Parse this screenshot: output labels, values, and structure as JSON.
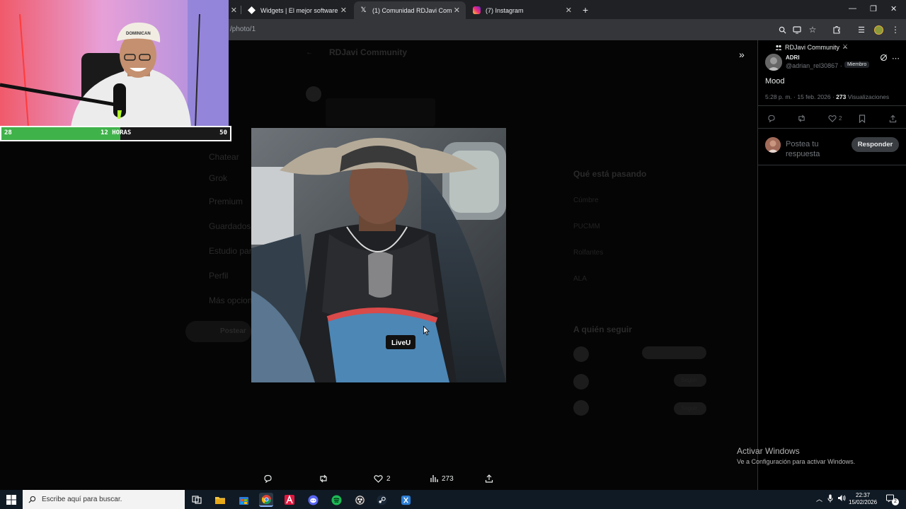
{
  "browser": {
    "tabs": [
      {
        "label": "Widgets | El mejor software pa",
        "favicon": "widgets-icon",
        "active": false
      },
      {
        "label": "(1) Comunidad RDJavi Commu",
        "favicon": "x-logo-icon",
        "active": true
      },
      {
        "label": "(7) Instagram",
        "favicon": "instagram-icon",
        "active": false
      }
    ],
    "address": "/photo/1"
  },
  "timer": {
    "left": "28",
    "center": "12 HORAS",
    "right": "50",
    "progress": 0.52,
    "accent": "#40b24a"
  },
  "background_page": {
    "header": "RDJavi Community",
    "nav": [
      "Chatear",
      "Grok",
      "Premium",
      "Guardados",
      "Estudio para",
      "Perfil",
      "Más opciones"
    ],
    "post_button": "Postear",
    "trending_title": "Qué está pasando",
    "trends": [
      "Cúmbre",
      "PUCMM",
      "Rolfantes",
      "ALA"
    ],
    "follow_title": "A quién seguir",
    "follow_buttons": [
      "Seguir",
      "Seguir"
    ],
    "follow_status": "Seguir"
  },
  "viewer": {
    "actions": [
      {
        "icon": "reply-icon",
        "count": ""
      },
      {
        "icon": "repost-icon",
        "count": ""
      },
      {
        "icon": "like-icon",
        "count": "2"
      },
      {
        "icon": "views-icon",
        "count": "273"
      },
      {
        "icon": "share-icon",
        "count": ""
      }
    ]
  },
  "post": {
    "community": "RDJavi Community",
    "author_name": "ADRI",
    "author_handle": "@adrian_rel30867 ·",
    "badge": "Miembro",
    "text": "Mood",
    "time": "5:28 p. m. · 15 feb. 2026 · ",
    "views": "273",
    "views_label": " Visualizaciones",
    "likes": "2",
    "reply_placeholder": "Postea tu respuesta",
    "reply_button": "Responder"
  },
  "windows_watermark": {
    "line1": "Activar Windows",
    "line2": "Ve a Configuración para activar Windows."
  },
  "taskbar": {
    "search_placeholder": "Escribe aquí para buscar.",
    "time": "22:37",
    "date": "15/02/2026",
    "notifications": "2"
  }
}
